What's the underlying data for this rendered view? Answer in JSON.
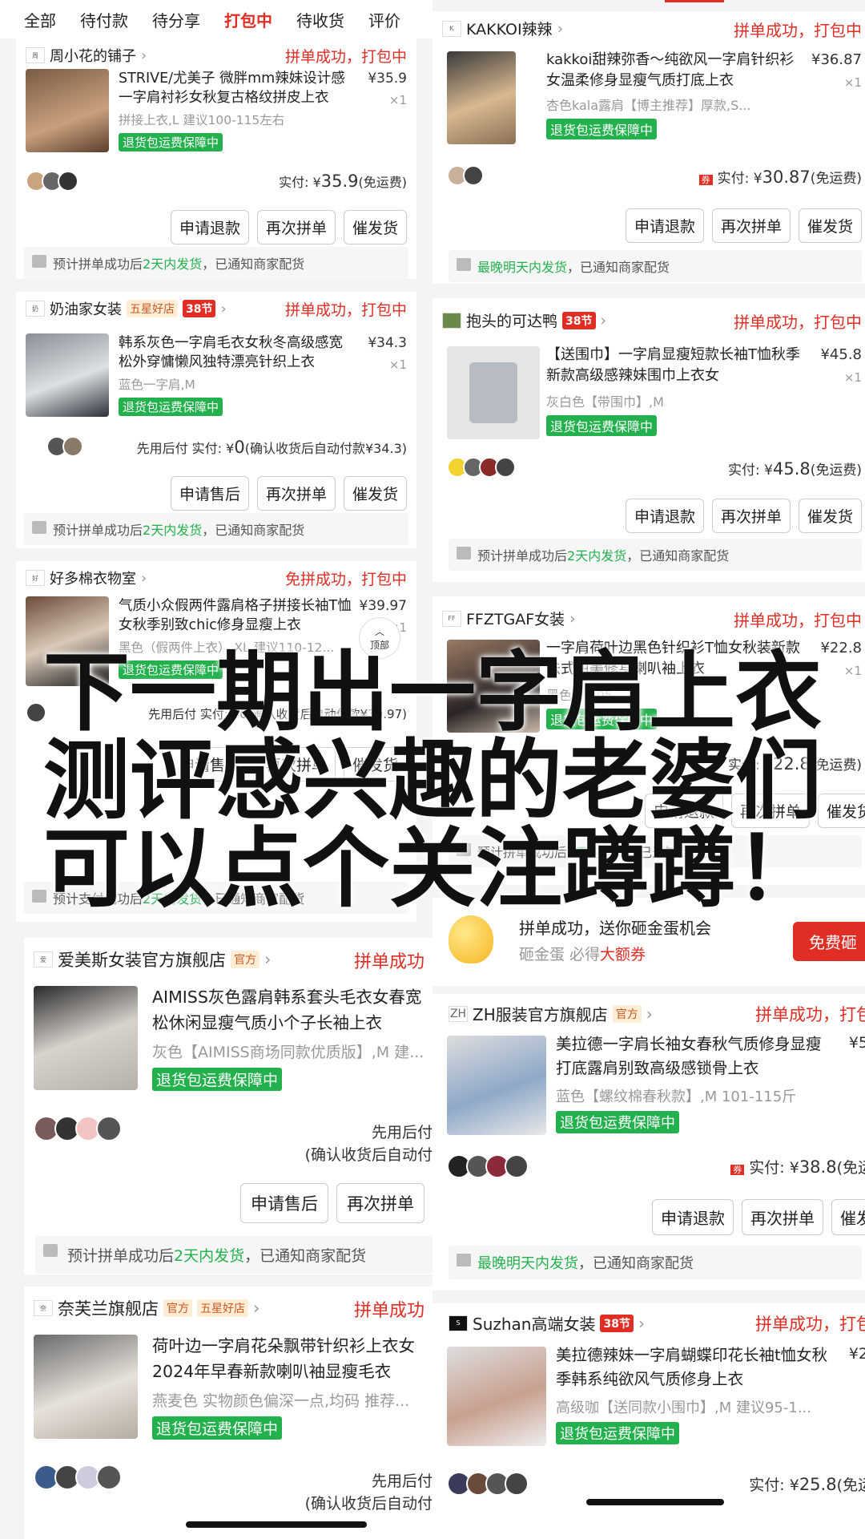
{
  "tabs": [
    "全部",
    "待付款",
    "待分享",
    "打包中",
    "待收货",
    "评价"
  ],
  "overlay": {
    "line1": "下一期出一字肩上衣",
    "line2": "测评感兴趣的老婆们",
    "line3": "可以点个关注蹲蹲！"
  },
  "back_to_top": "顶部",
  "left": [
    {
      "shop": "周小花的铺子",
      "status": "拼单成功，打包中",
      "title": "STRIVE/尤美子 微胖mm辣妹设计感一字肩衬衫女秋复古格纹拼皮上衣",
      "spec": "拼接上衣,L 建议100-115左右",
      "badge": "退货包运费保障中",
      "price": "¥35.9",
      "qty": "×1",
      "paid": "实付: ¥",
      "paid_amount": "35.9",
      "paid_suffix": "(免运费)",
      "btns": [
        "申请退款",
        "再次拼单",
        "催发货"
      ],
      "notice_pre": "预计拼单成功后",
      "notice_g": "2天内发货",
      "notice_post": "，已通知商家配货"
    },
    {
      "shop": "奶油家女装",
      "tagA": "五星好店",
      "tagB": "38节",
      "status": "拼单成功，打包中",
      "title": "韩系灰色一字肩毛衣女秋冬高级感宽松外穿慵懒风独特漂亮针织上衣",
      "spec": "蓝色一字肩,M",
      "badge": "退货包运费保障中",
      "price": "¥34.3",
      "qty": "×1",
      "paid": "先用后付 实付: ¥",
      "paid_amount": "0",
      "paid_suffix": "(确认收货后自动付款¥34.3)",
      "btns": [
        "申请售后",
        "再次拼单",
        "催发货"
      ],
      "notice_pre": "预计拼单成功后",
      "notice_g": "2天内发货",
      "notice_post": "，已通知商家配货"
    },
    {
      "shop": "好多棉衣物室",
      "status": "免拼成功，打包中",
      "title": "气质小众假两件露肩格子拼接长袖T恤女秋季别致chic修身显瘦上衣",
      "spec": "黑色（假两件上衣）,XL 建议110-12...",
      "badge": "退货包运费保障中",
      "price": "¥39.97",
      "qty": "×1",
      "paid": "先用后付 实付: ¥0(确认收货后自动付款¥39.97)",
      "btns": [
        "申请售后",
        "再次拼单",
        "催发货"
      ],
      "notice_pre": "预计支付成功后",
      "notice_g": "2天内发货",
      "notice_post": "，已通知商家配货"
    },
    {
      "shop": "爱美斯女装官方旗舰店",
      "tagA": "官方",
      "status": "拼单成功",
      "title": "AIMISS灰色露肩韩系套头毛衣女春宽松休闲显瘦气质小个子长袖上衣",
      "spec": "灰色【AIMISS商场同款优质版】,M 建...",
      "badge": "退货包运费保障中",
      "paid": "先用后付",
      "paid2": "(确认收货后自动付",
      "btns": [
        "申请售后",
        "再次拼单"
      ],
      "notice_pre": "预计拼单成功后",
      "notice_g": "2天内发货",
      "notice_post": "，已通知商家配货"
    },
    {
      "shop": "奈芙兰旗舰店",
      "tagA": "官方",
      "tagA2": "五星好店",
      "status": "拼单成功",
      "title": "荷叶边一字肩花朵飘带针织衫上衣女2024年早春新款喇叭袖显瘦毛衣",
      "spec": "燕麦色 实物颜色偏深一点,均码 推荐...",
      "badge": "退货包运费保障中",
      "paid": "先用后付",
      "paid2": "(确认收货后自动付"
    }
  ],
  "right": [
    {
      "shop": "KAKKOI辣辣",
      "status": "拼单成功，打包中",
      "title": "kakkoi甜辣弥香～纯欲风一字肩针织衫女温柔修身显瘦气质打底上衣",
      "spec": "杏色kala露肩【博主推荐】厚款,S...",
      "badge": "退货包运费保障中",
      "price": "¥36.87",
      "qty": "×1",
      "paid": "实付: ¥",
      "paid_amount": "30.87",
      "paid_suffix": "(免运费)",
      "btns": [
        "申请退款",
        "再次拼单",
        "催发货"
      ],
      "notice_g": "最晚明天内发货",
      "notice_post": "，已通知商家配货"
    },
    {
      "shop": "抱头的可达鸭",
      "tagB": "38节",
      "status": "拼单成功，打包中",
      "title": "【送围巾】一字肩显瘦短款长袖T恤秋季新款高级感辣妹围巾上衣女",
      "spec": "灰白色【带围巾】,M",
      "badge": "退货包运费保障中",
      "price": "¥45.8",
      "qty": "×1",
      "paid": "实付: ¥",
      "paid_amount": "45.8",
      "paid_suffix": "(免运费)",
      "btns": [
        "申请退款",
        "再次拼单",
        "催发货"
      ],
      "notice_pre": "预计拼单成功后",
      "notice_g": "2天内发货",
      "notice_post": "，已通知商家配货"
    },
    {
      "shop": "FFZTGAF女装",
      "status": "拼单成功，打包中",
      "title": "一字肩荷叶边黑色针织衫T恤女秋装新款法式甜美修身喇叭袖上衣",
      "spec": "黑色,S 105",
      "badge": "退货包运费保障中",
      "price": "¥22.8",
      "qty": "×1",
      "paid": "实付: ¥",
      "paid_amount": "22.8",
      "paid_suffix": "(免运费)",
      "btns": [
        "申请退款",
        "再次拼单",
        "催发货"
      ],
      "notice_pre": "预计拼单成功后",
      "notice_g": "2天内发货",
      "notice_post": "，已通知商家配货"
    },
    {
      "promo_title": "拼单成功，送你砸金蛋机会",
      "promo_sub_pre": "砸金蛋 必得",
      "promo_sub_red": "大额券",
      "promo_btn": "免费砸"
    },
    {
      "shop": "ZH服装官方旗舰店",
      "tagA": "官方",
      "status": "拼单成功，打包",
      "title": "美拉德一字肩长袖女春秋气质修身显瘦打底露肩别致高级感锁骨上衣",
      "spec": "蓝色【螺纹棉春秋款】,M 101-115斤",
      "badge": "退货包运费保障中",
      "price": "¥5",
      "paid": "实付: ¥",
      "paid_amount": "38.8",
      "paid_suffix": "(免运",
      "btns": [
        "申请退款",
        "再次拼单",
        "催发货"
      ],
      "notice_g": "最晚明天内发货",
      "notice_post": "，已通知商家配货"
    },
    {
      "shop": "Suzhan高端女装",
      "tagB": "38节",
      "status": "拼单成功，打包",
      "title": "美拉德辣妹一字肩蝴蝶印花长袖t恤女秋季韩系纯欲风气质修身上衣",
      "spec": "高级咖【送同款小围巾】,M 建议95-1...",
      "badge": "退货包运费保障中",
      "price": "¥2",
      "paid": "实付: ¥",
      "paid_amount": "25.8",
      "paid_suffix": "(免运"
    }
  ]
}
